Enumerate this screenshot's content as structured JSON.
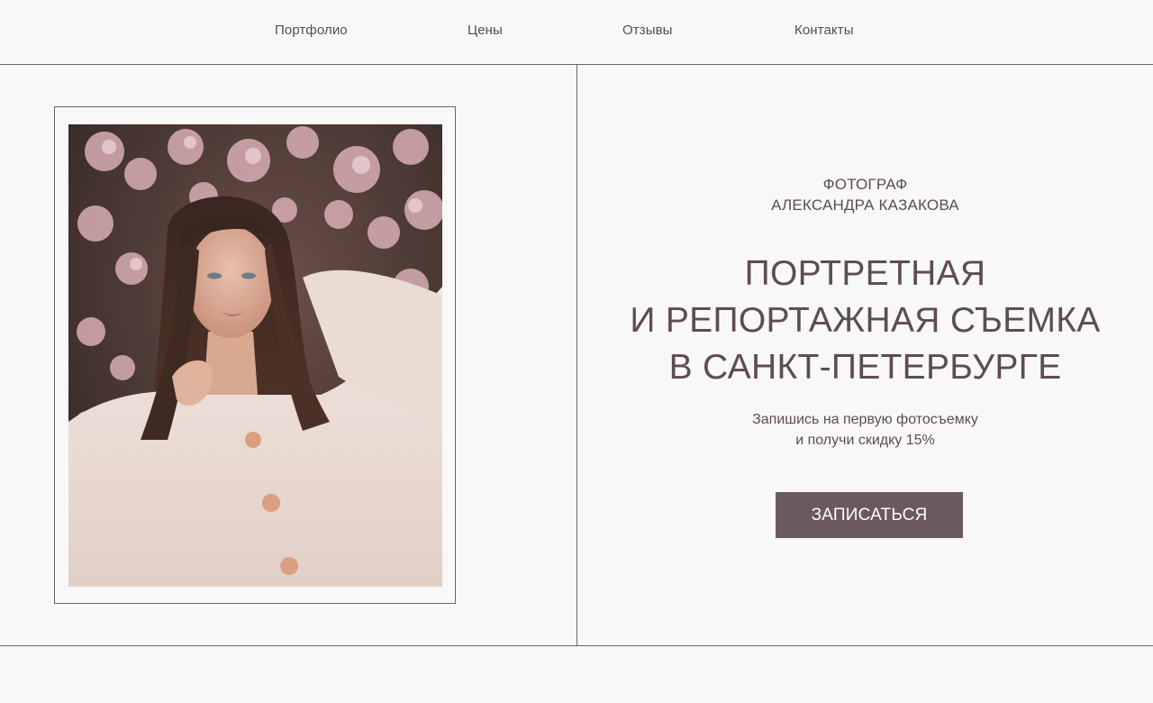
{
  "nav": {
    "items": [
      {
        "label": "Портфолио"
      },
      {
        "label": "Цены"
      },
      {
        "label": "Отзывы"
      },
      {
        "label": "Контакты"
      }
    ]
  },
  "hero": {
    "eyebrow_line1": "ФОТОГРАФ",
    "eyebrow_line2": "АЛЕКСАНДРА КАЗАКОВА",
    "headline_line1": "ПОРТРЕТНАЯ",
    "headline_line2": "И РЕПОРТАЖНАЯ СЪЕМКА",
    "headline_line3": "В САНКТ-ПЕТЕРБУРГЕ",
    "offer_line1": "Запишись на первую фотосъемку",
    "offer_line2": "и получи скидку 15%",
    "cta_label": "ЗАПИСАТЬСЯ"
  },
  "colors": {
    "background": "#f9f8f8",
    "text": "#5d4c50",
    "accent_button": "#6a5a5e",
    "rules": "#6f6266"
  }
}
